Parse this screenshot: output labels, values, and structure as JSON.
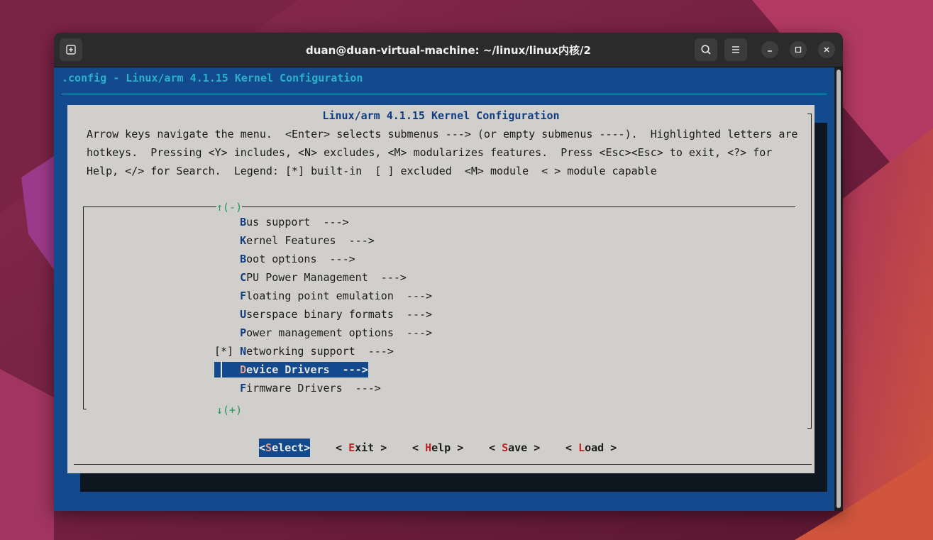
{
  "window": {
    "title": "duan@duan-virtual-machine: ~/linux/linux内核/2"
  },
  "terminal": {
    "config_title": ".config - Linux/arm 4.1.15 Kernel Configuration",
    "dialog": {
      "title": "Linux/arm 4.1.15 Kernel Configuration",
      "help_lines": [
        "Arrow keys navigate the menu.  <Enter> selects submenus ---> (or empty submenus ----).  Highlighted letters are",
        "hotkeys.  Pressing <Y> includes, <N> excludes, <M> modularizes features.  Press <Esc><Esc> to exit, <?> for",
        "Help, </> for Search.  Legend: [*] built-in  [ ] excluded  <M> module  < > module capable"
      ],
      "scroll_up_indicator": "↑(-)",
      "scroll_down_indicator": "↓(+)",
      "menu_items": [
        {
          "prefix": "    ",
          "hotkey": "B",
          "rest": "us support  --->",
          "selected": false
        },
        {
          "prefix": "    ",
          "hotkey": "K",
          "rest": "ernel Features  --->",
          "selected": false
        },
        {
          "prefix": "    ",
          "hotkey": "B",
          "rest": "oot options  --->",
          "selected": false
        },
        {
          "prefix": "    ",
          "hotkey": "C",
          "rest": "PU Power Management  --->",
          "selected": false
        },
        {
          "prefix": "    ",
          "hotkey": "F",
          "rest": "loating point emulation  --->",
          "selected": false
        },
        {
          "prefix": "    ",
          "hotkey": "U",
          "rest": "serspace binary formats  --->",
          "selected": false
        },
        {
          "prefix": "    ",
          "hotkey": "P",
          "rest": "ower management options  --->",
          "selected": false
        },
        {
          "prefix": "[*] ",
          "hotkey": "N",
          "rest": "etworking support  --->",
          "selected": false
        },
        {
          "prefix": "    ",
          "hotkey": "D",
          "rest": "evice Drivers  --->",
          "selected": true
        },
        {
          "prefix": "    ",
          "hotkey": "F",
          "rest": "irmware Drivers  --->",
          "selected": false
        }
      ],
      "buttons": [
        {
          "open": "<",
          "hotkey": "S",
          "rest": "elect",
          "close": ">",
          "selected": true
        },
        {
          "open": "< ",
          "hotkey": "E",
          "rest": "xit",
          "close": " >",
          "selected": false
        },
        {
          "open": "< ",
          "hotkey": "H",
          "rest": "elp",
          "close": " >",
          "selected": false
        },
        {
          "open": "< ",
          "hotkey": "S",
          "rest": "ave",
          "close": " >",
          "selected": false
        },
        {
          "open": "< ",
          "hotkey": "L",
          "rest": "oad",
          "close": " >",
          "selected": false
        }
      ]
    }
  },
  "colors": {
    "terminal_bg": "#134a8d",
    "dialog_bg": "#d1cfcb",
    "accent_cyan": "#2bb0c9",
    "hotkey_blue": "#113e82",
    "button_hotkey_red": "#c02424",
    "indicator_green": "#1f9a55"
  },
  "icons": {
    "new_tab": "new-tab-icon",
    "search": "search-icon",
    "menu": "hamburger-menu-icon",
    "minimize": "minimize-icon",
    "maximize": "maximize-icon",
    "close": "close-icon"
  }
}
